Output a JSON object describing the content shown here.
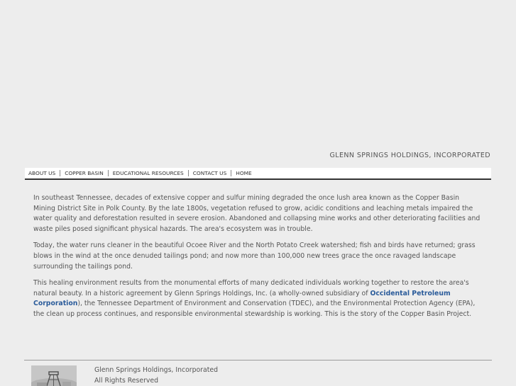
{
  "header": {
    "company_name": "GLENN SPRINGS HOLDINGS, INCORPORATED"
  },
  "nav": {
    "items": [
      {
        "label": "ABOUT US"
      },
      {
        "label": "COPPER BASIN"
      },
      {
        "label": "EDUCATIONAL RESOURCES"
      },
      {
        "label": "CONTACT US"
      },
      {
        "label": "HOME"
      }
    ]
  },
  "content": {
    "p1": "In southeast Tennessee, decades of extensive copper and sulfur mining degraded the once lush area known as the Copper Basin Mining District Site in Polk County. By the late 1800s, vegetation refused to grow, acidic conditions and leaching metals impaired the water quality and deforestation resulted in severe erosion. Abandoned and collapsing mine works and other deteriorating facilities and waste piles posed significant physical hazards. The area's ecosystem was in trouble.",
    "p2": "Today, the water runs cleaner in the beautiful Ocoee River and the North Potato Creek watershed; fish and birds have returned; grass blows in the wind at the once denuded tailings pond; and now more than 100,000 new trees grace the once ravaged landscape surrounding the tailings pond.",
    "p3_before": "This healing environment results from the monumental efforts of many dedicated individuals working together to restore the area's natural beauty. In a historic agreement by Glenn Springs Holdings, Inc. (a wholly-owned subsidiary of ",
    "p3_link": "Occidental Petroleum Corporation",
    "p3_after": "), the Tennessee Department of Environment and Conservation (TDEC), and the Environmental Protection Agency (EPA), the clean up process continues, and responsible environmental stewardship is working. This is the story of the Copper Basin Project."
  },
  "footer": {
    "line1": "Glenn Springs Holdings, Incorporated",
    "line2": "All Rights Reserved",
    "image_icon": "mine-headframe-photo"
  }
}
